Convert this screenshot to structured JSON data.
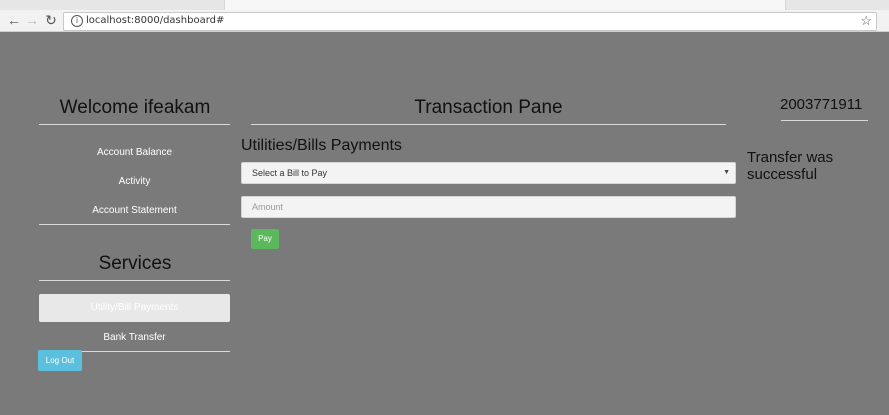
{
  "browser": {
    "address": "localhost:8000/dashboard#",
    "icons": {
      "back": "back-arrow-icon",
      "forward": "forward-arrow-icon",
      "reload": "reload-icon",
      "info": "info-icon",
      "bookmark": "star-icon"
    }
  },
  "sidebar": {
    "welcome": "Welcome ifeakam",
    "items": [
      {
        "label": "Account Balance"
      },
      {
        "label": "Activity"
      },
      {
        "label": "Account Statement"
      }
    ],
    "services_title": "Services",
    "services": [
      {
        "label": "Utility/Bill Payments",
        "active": true
      },
      {
        "label": "Bank Transfer",
        "active": false
      }
    ],
    "logout_label": "Log Out"
  },
  "main": {
    "pane_title": "Transaction Pane",
    "section_title": "Utilities/Bills Payments",
    "select_value": "Select a Bill to Pay",
    "amount_placeholder": "Amount",
    "pay_label": "Pay"
  },
  "right": {
    "account_number": "2003771911",
    "message": "Transfer was successful"
  },
  "colors": {
    "background": "#7a7a7a",
    "pay_button": "#5cb85c",
    "logout_button": "#5bc0de"
  }
}
